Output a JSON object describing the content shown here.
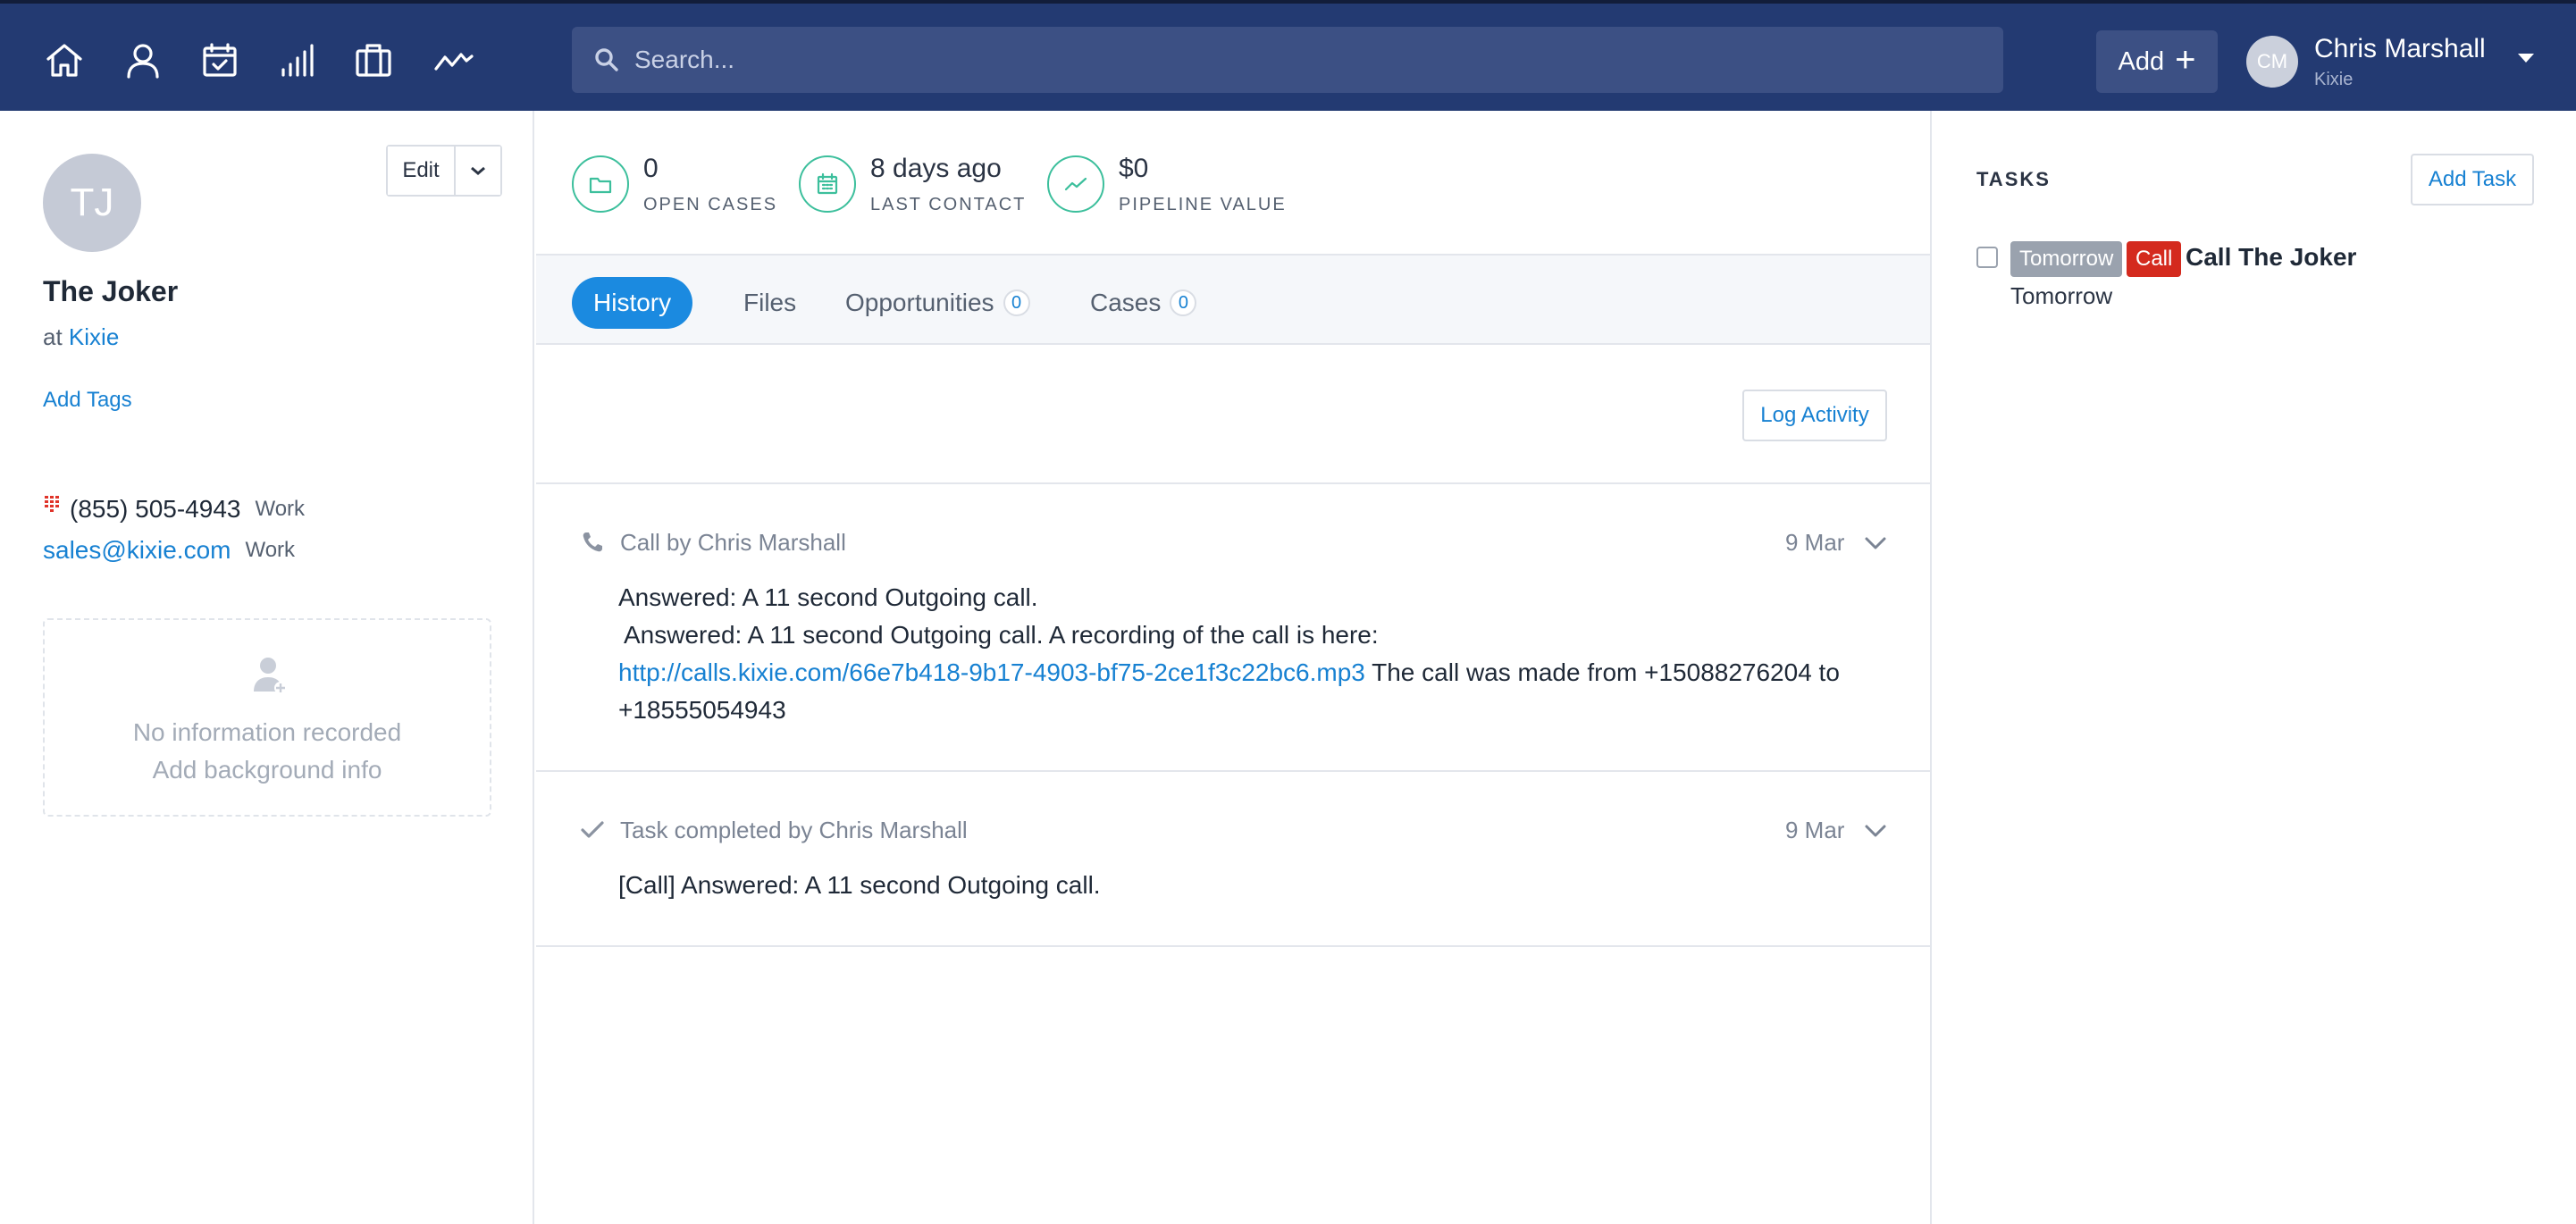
{
  "nav": {
    "icons": [
      "home-icon",
      "person-icon",
      "calendar-icon",
      "bar-chart-icon",
      "briefcase-icon",
      "activity-icon"
    ],
    "search_placeholder": "Search...",
    "add_label": "Add",
    "user": {
      "initials": "CM",
      "name": "Chris Marshall",
      "org": "Kixie"
    }
  },
  "contact": {
    "initials": "TJ",
    "name": "The Joker",
    "at_label": "at",
    "org": "Kixie",
    "edit_label": "Edit",
    "add_tags": "Add Tags",
    "phone": "(855) 505-4943",
    "phone_type": "Work",
    "email": "sales@kixie.com",
    "email_type": "Work",
    "background": {
      "line1": "No information recorded",
      "line2": "Add background info"
    }
  },
  "stats": [
    {
      "value": "0",
      "label": "OPEN CASES",
      "icon": "folder-icon"
    },
    {
      "value": "8 days ago",
      "label": "LAST CONTACT",
      "icon": "calendar-icon"
    },
    {
      "value": "$0",
      "label": "PIPELINE VALUE",
      "icon": "trend-icon"
    }
  ],
  "tabs": [
    {
      "label": "History",
      "active": true
    },
    {
      "label": "Files"
    },
    {
      "label": "Opportunities",
      "count": "0"
    },
    {
      "label": "Cases",
      "count": "0"
    }
  ],
  "log_activity_label": "Log Activity",
  "activities": [
    {
      "icon": "phone-icon",
      "title": "Call by Chris Marshall",
      "date": "9 Mar",
      "line1": "Answered: A 11 second Outgoing call.",
      "line2": "Answered: A 11 second Outgoing call. A recording of the call is here:",
      "link": "http://calls.kixie.com/66e7b418-9b17-4903-bf75-2ce1f3c22bc6.mp3",
      "line3": " The call was made from +15088276204 to +18555054943"
    },
    {
      "icon": "checkmark-icon",
      "title": "Task completed by Chris Marshall",
      "date": "9 Mar",
      "line1": "[Call] Answered: A 11 second Outgoing call."
    }
  ],
  "tasks": {
    "title": "TASKS",
    "add_label": "Add Task",
    "items": [
      {
        "when_badge": "Tomorrow",
        "type_badge": "Call",
        "name": "Call The Joker",
        "due": "Tomorrow"
      }
    ]
  },
  "colors": {
    "nav_bg": "#233a72",
    "accent": "#1b8ae0",
    "link": "#1781d2",
    "stat_green": "#3cbf9c",
    "call_red": "#d42a1e"
  }
}
